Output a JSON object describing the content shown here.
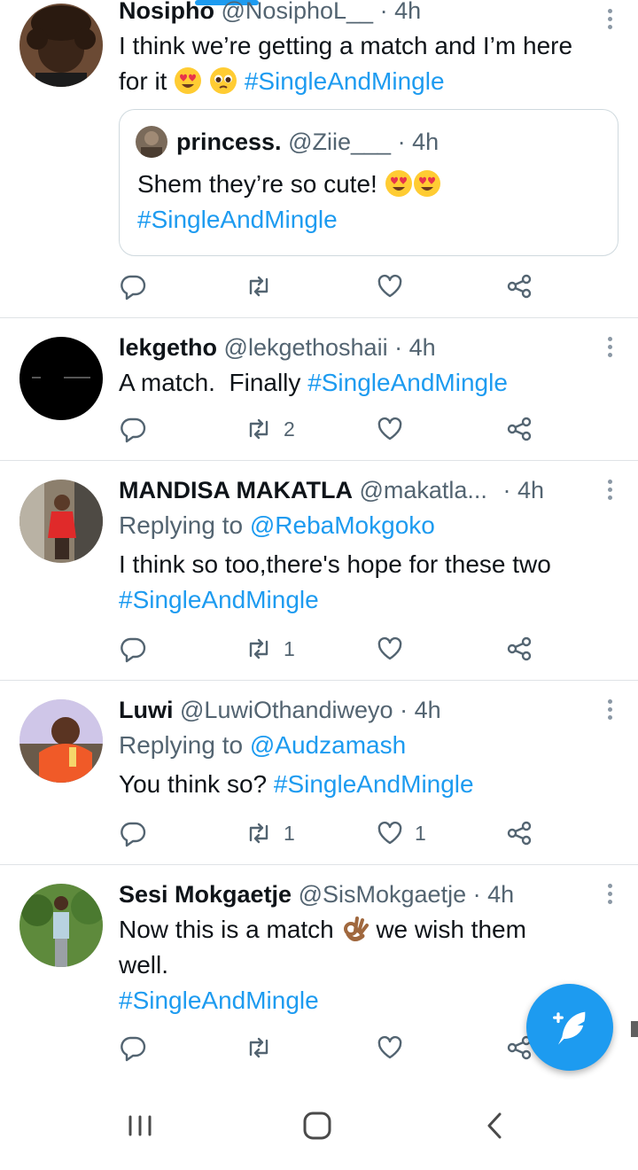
{
  "colors": {
    "accent": "#1d9bf0",
    "text": "#0f1419",
    "muted": "#536471",
    "divider": "#dfe3e6"
  },
  "tweets": [
    {
      "name": "Nosipho",
      "handle": "@NosiphoL__",
      "dot": "·",
      "time": "4h",
      "text_lines": [
        "I think we’re getting a match and I’m here",
        "for it"
      ],
      "hashtag": "#SingleAndMingle",
      "emojis": [
        "smiling-face-with-heart-eyes",
        "pleading-face"
      ],
      "quote": {
        "name": "princess.",
        "handle": "@Ziie___",
        "dot": "·",
        "time": "4h",
        "text": "Shem they’re so cute!",
        "emojis": [
          "smiling-face-with-heart-eyes",
          "smiling-face-with-heart-eyes"
        ],
        "hashtag": "#SingleAndMingle"
      },
      "counts": {
        "reply": "",
        "retweet": "",
        "like": ""
      }
    },
    {
      "name": "lekgetho",
      "handle": "@lekgethoshaii",
      "dot": "·",
      "time": "4h",
      "text": "A match.  Finally",
      "hashtag": "#SingleAndMingle",
      "counts": {
        "reply": "",
        "retweet": "2",
        "like": ""
      }
    },
    {
      "name": "MANDISA MAKATLA",
      "handle": "@makatla...",
      "dot": "·",
      "time": "4h",
      "replying_prefix": "Replying to",
      "replying_to": "@RebaMokgoko",
      "text": "I think so too,there's hope for these two",
      "hashtag": "#SingleAndMingle",
      "counts": {
        "reply": "",
        "retweet": "1",
        "like": ""
      }
    },
    {
      "name": "Luwi",
      "handle": "@LuwiOthandiweyo",
      "dot": "·",
      "time": "4h",
      "replying_prefix": "Replying to",
      "replying_to": "@Audzamash",
      "text": "You think so?",
      "hashtag": "#SingleAndMingle",
      "counts": {
        "reply": "",
        "retweet": "1",
        "like": "1"
      }
    },
    {
      "name": "Sesi Mokgaetje",
      "handle": "@SisMokgaetje",
      "dot": "·",
      "time": "4h",
      "text_before_emoji": "Now this is a match",
      "emoji": "ok-hand",
      "text_after_emoji": "we wish them",
      "text_line2": "well.",
      "hashtag": "#SingleAndMingle",
      "counts": {
        "reply": "",
        "retweet": "",
        "like": ""
      }
    }
  ],
  "fab": {
    "icon": "compose-tweet-icon"
  },
  "navbar": {
    "icons": [
      "recent-apps-icon",
      "home-icon",
      "back-icon"
    ]
  }
}
